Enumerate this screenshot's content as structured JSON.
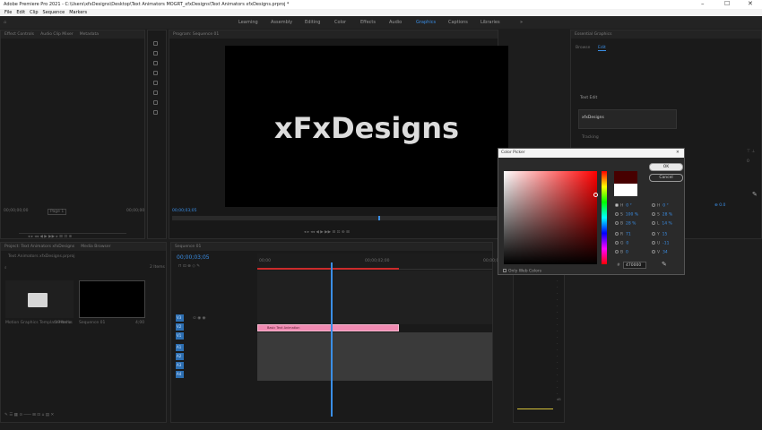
{
  "window": {
    "title": "Adobe Premiere Pro 2021 - C:\\Users\\xfxDesigns\\Desktop\\Text Animators MOGRT_xfxDesigns\\Text Animators xfxDesigns.prproj *",
    "min": "–",
    "max": "☐",
    "close": "✕"
  },
  "menu": [
    "File",
    "Edit",
    "Clip",
    "Sequence",
    "Markers"
  ],
  "workspaces": {
    "items": [
      "Learning",
      "Assembly",
      "Editing",
      "Color",
      "Effects",
      "Audio",
      "Graphics",
      "Captions",
      "Libraries"
    ],
    "active": "Graphics",
    "more": "»"
  },
  "source": {
    "tabs": [
      "Effect Controls",
      "Audio Clip Mixer",
      "Metadata"
    ],
    "timecode": "00;00;00;00",
    "fit": "Page 1",
    "end": "00;00;00"
  },
  "program": {
    "tab": "Program: Sequence 01",
    "preview_text": "xFxDesigns",
    "timecode": "00;00;03;05"
  },
  "project": {
    "tab": "Project: Text Animators xfxDesigns",
    "tab2": "Media Browser",
    "path": "Text Animators xfxDesigns.prproj",
    "items_count": "2 Items",
    "bins": [
      {
        "name": "Motion Graphics Template Media",
        "count": "19 Items"
      },
      {
        "name": "Sequence 01",
        "duration": "4;00"
      }
    ]
  },
  "timeline": {
    "tab": "Sequence 01",
    "timecode": "00;00;03;05",
    "ruler": [
      "00;00",
      "00;00;02;00",
      "00;00;04;00"
    ],
    "clip_label": "Basic Text Animation",
    "tracks_v": [
      "V3",
      "V2",
      "V1"
    ],
    "tracks_a": [
      "A1",
      "A2",
      "A3",
      "A4"
    ]
  },
  "essential": {
    "tab": "Essential Graphics",
    "browse": "Browse",
    "edit": "Edit",
    "section": "Text Edit",
    "text_value": "xfxDesigns",
    "field_label": "Tracking",
    "align_value": "0"
  },
  "color_picker": {
    "title": "Color Picker",
    "ok": "OK",
    "cancel": "Cancel",
    "only_web": "Only Web Colors",
    "hex_prefix": "#",
    "hex": "470000",
    "left_rows": [
      {
        "k": "H",
        "v": "0 °",
        "sel": true
      },
      {
        "k": "S",
        "v": "100 %",
        "sel": false
      },
      {
        "k": "B",
        "v": "28 %",
        "sel": false
      },
      {
        "k": "R",
        "v": "71",
        "sel": false
      },
      {
        "k": "G",
        "v": "0",
        "sel": false
      },
      {
        "k": "B",
        "v": "0",
        "sel": false
      }
    ],
    "right_rows": [
      {
        "k": "H",
        "v": "0 °"
      },
      {
        "k": "S",
        "v": "28 %"
      },
      {
        "k": "L",
        "v": "14 %"
      },
      {
        "k": "Y",
        "v": "15"
      },
      {
        "k": "U",
        "v": "-11"
      },
      {
        "k": "V",
        "v": "34"
      }
    ]
  },
  "colors": {
    "accent": "#3a8ee6",
    "clip": "#f08bb2",
    "playhead": "#3a8ee6",
    "hex_color": "#470000"
  }
}
